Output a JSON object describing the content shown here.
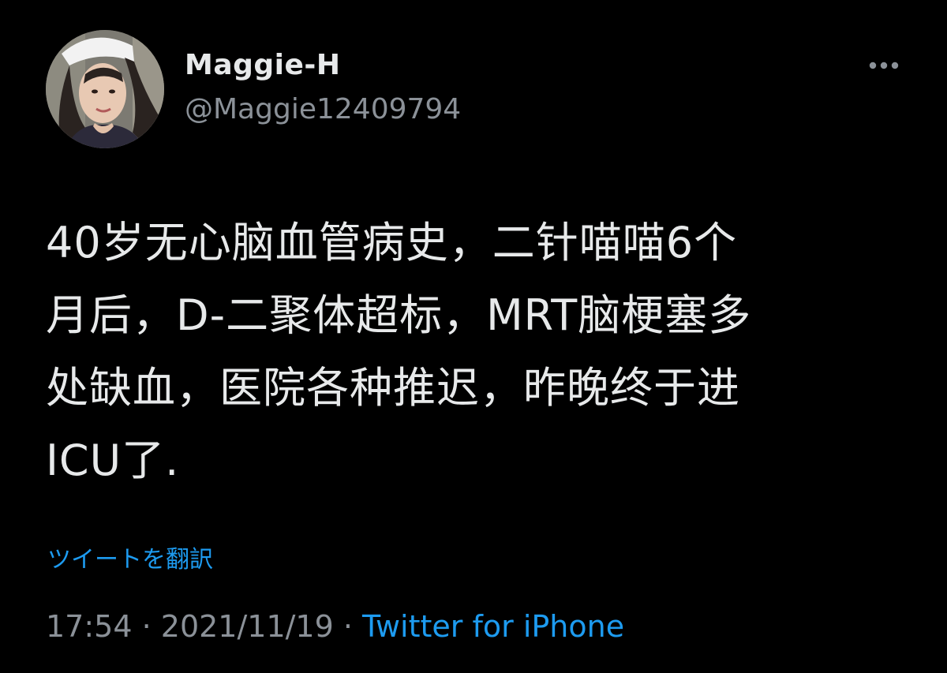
{
  "theme": {
    "background": "#000000",
    "text": "#e7e9ea",
    "muted": "#8b9198",
    "accent": "#1d9bf0"
  },
  "user": {
    "display_name": "Maggie-H",
    "handle": "@Maggie12409794",
    "avatar_icon": "profile-photo"
  },
  "header": {
    "more_icon": "more-horizontal-icon"
  },
  "tweet": {
    "text": "40岁无心脑血管病史，二针喵喵6个\n月后，D-二聚体超标，MRT脑梗塞多\n处缺血，医院各种推迟，昨晚终于进\nICU了.",
    "translate_label": "ツイートを翻訳"
  },
  "meta": {
    "time": "17:54",
    "separator": " · ",
    "date": "2021/11/19",
    "source": "Twitter for iPhone"
  }
}
